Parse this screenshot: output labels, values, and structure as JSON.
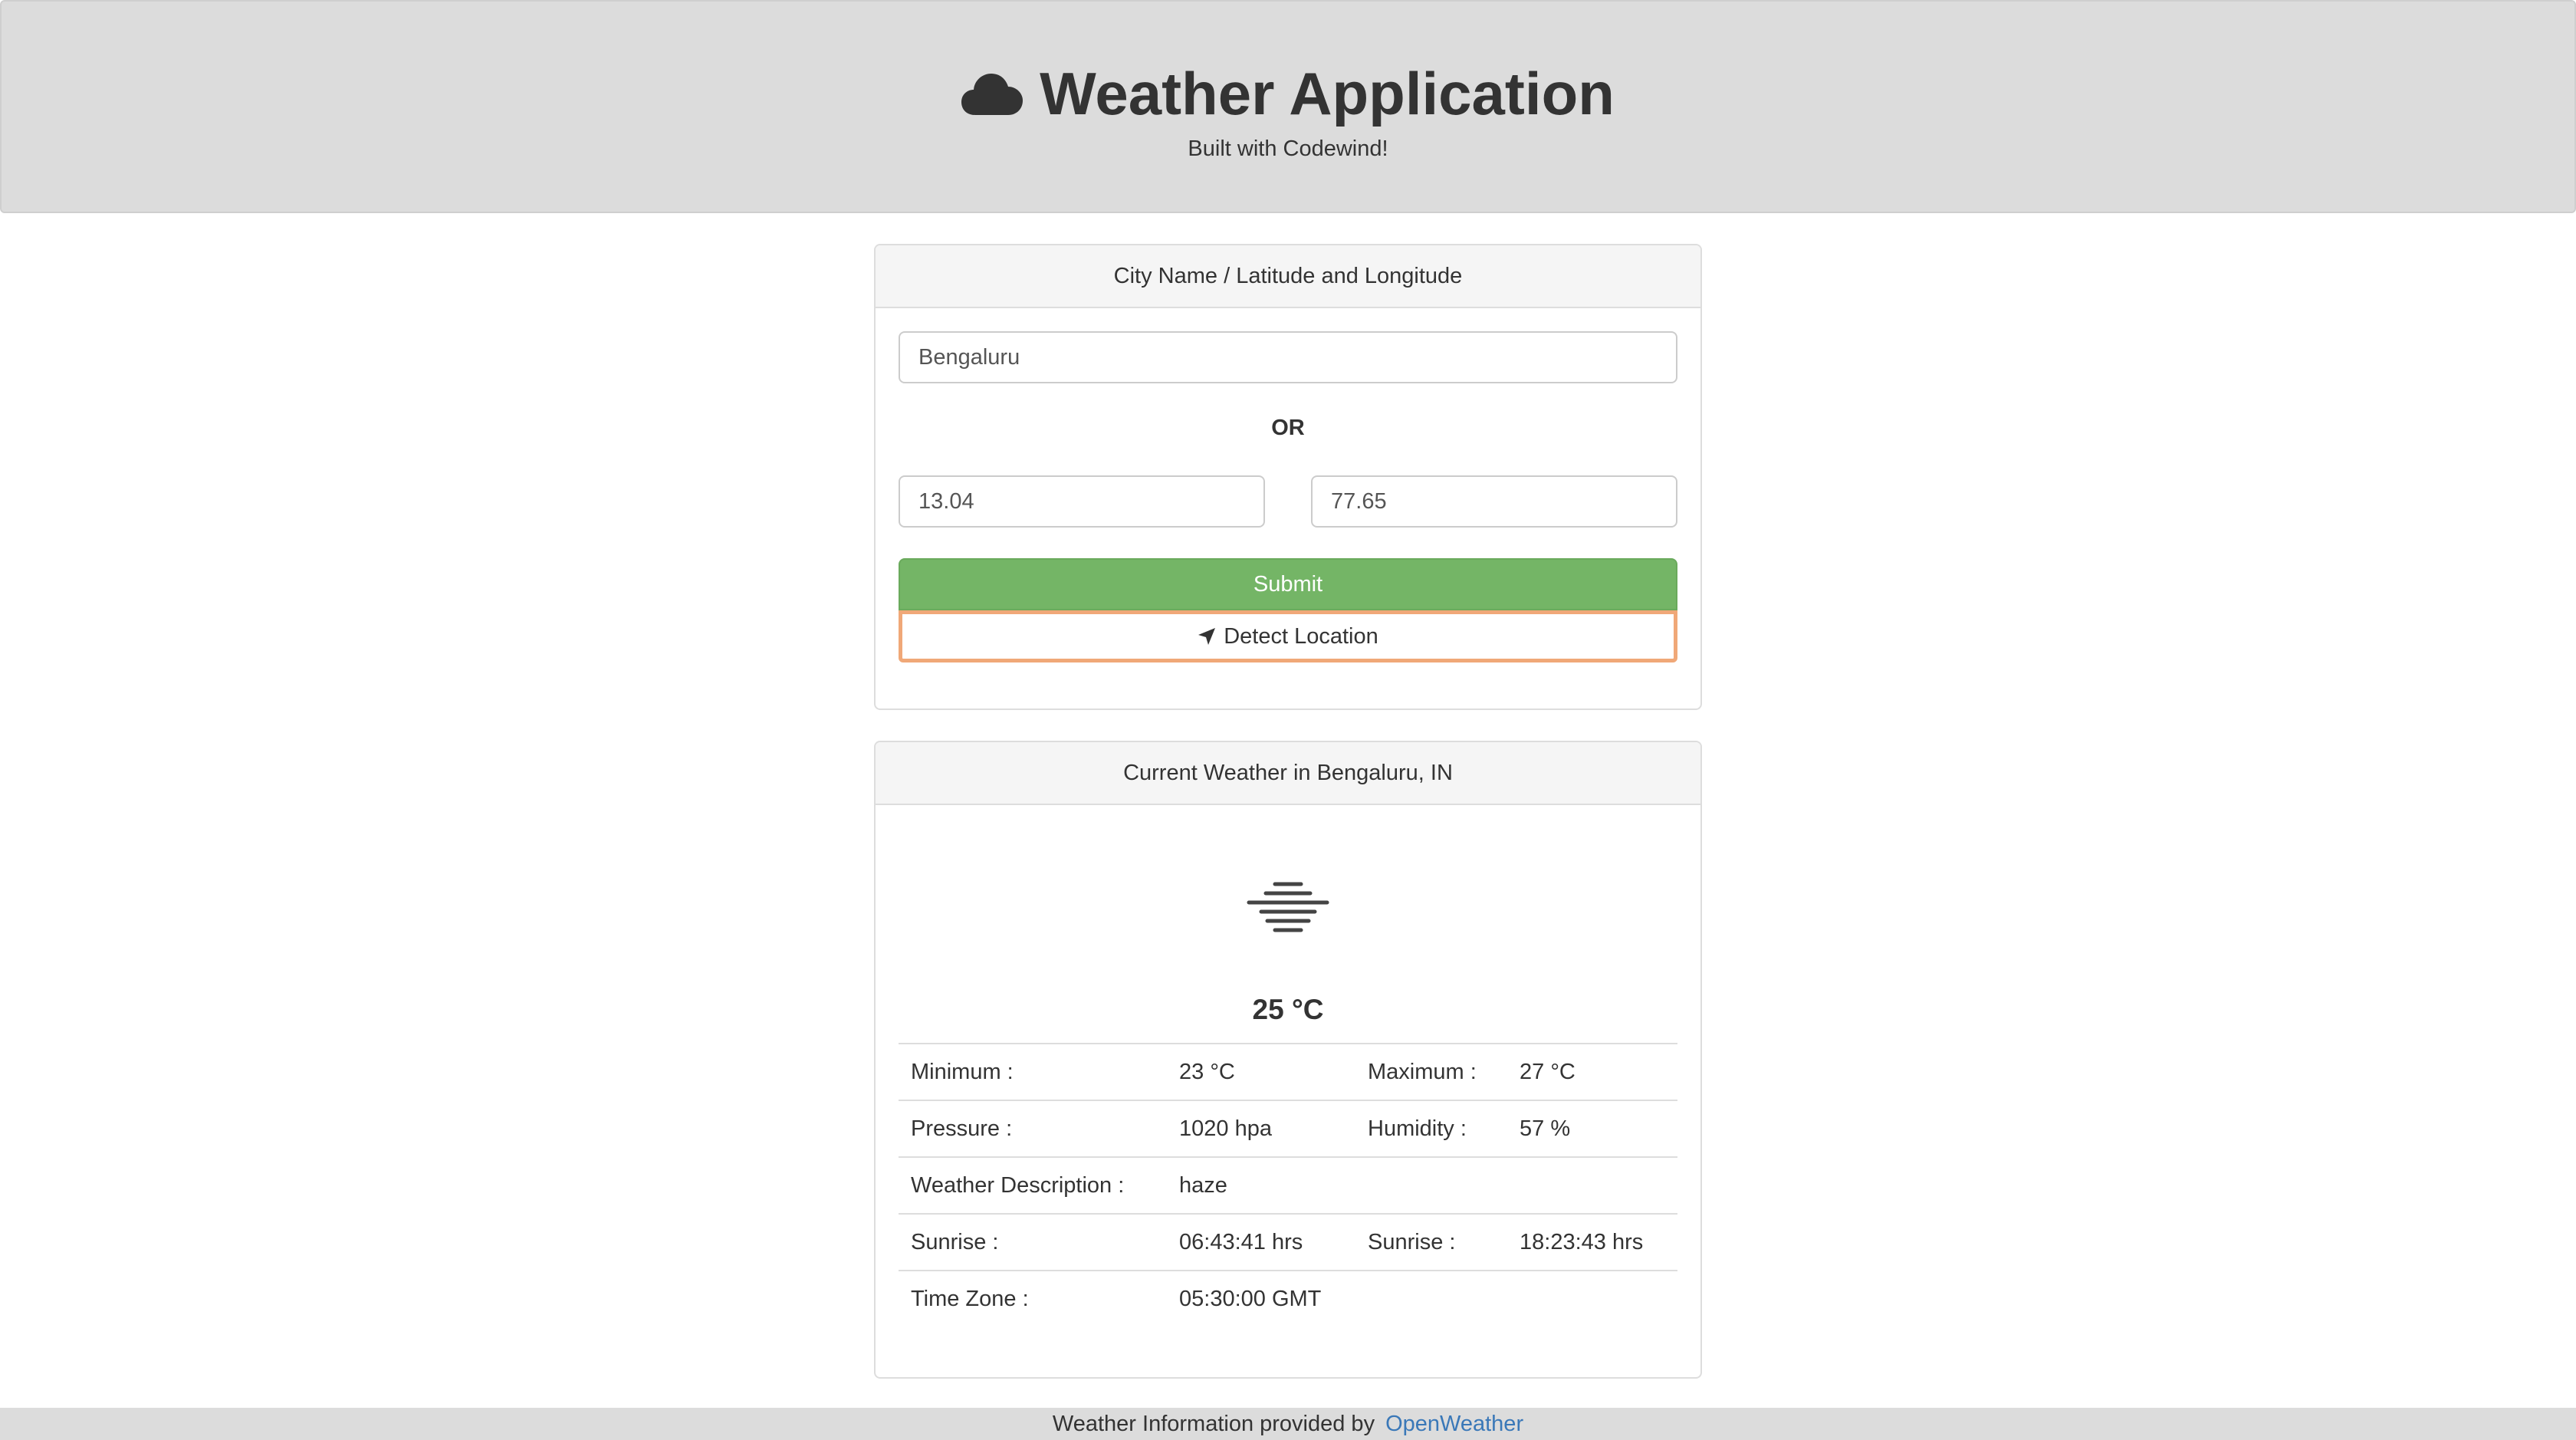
{
  "header": {
    "title": "Weather Application",
    "subtitle": "Built with Codewind!"
  },
  "location_form": {
    "heading": "City Name / Latitude and Longitude",
    "city_value": "Bengaluru",
    "or_label": "OR",
    "latitude_value": "13.04",
    "longitude_value": "77.65",
    "submit_label": "Submit",
    "detect_label": "Detect Location",
    "detect_icon": "location-arrow-icon",
    "focus_color": "#f0a878",
    "submit_color": "#74b566"
  },
  "weather": {
    "heading": "Current Weather in Bengaluru, IN",
    "icon": "haze-icon",
    "temperature": "25 °C",
    "rows": [
      {
        "label1": "Minimum :",
        "value1": "23 °C",
        "label2": "Maximum :",
        "value2": "27 °C"
      },
      {
        "label1": "Pressure :",
        "value1": "1020 hpa",
        "label2": "Humidity :",
        "value2": "57 %"
      },
      {
        "label1": "Weather Description :",
        "value1": "haze",
        "label2": "",
        "value2": ""
      },
      {
        "label1": "Sunrise :",
        "value1": "06:43:41 hrs",
        "label2": "Sunrise :",
        "value2": "18:23:43 hrs"
      },
      {
        "label1": "Time Zone :",
        "value1": "05:30:00 GMT",
        "label2": "",
        "value2": ""
      }
    ]
  },
  "footer": {
    "text": "Weather Information provided by",
    "link_label": "OpenWeather",
    "link_color": "#3a78b8"
  }
}
